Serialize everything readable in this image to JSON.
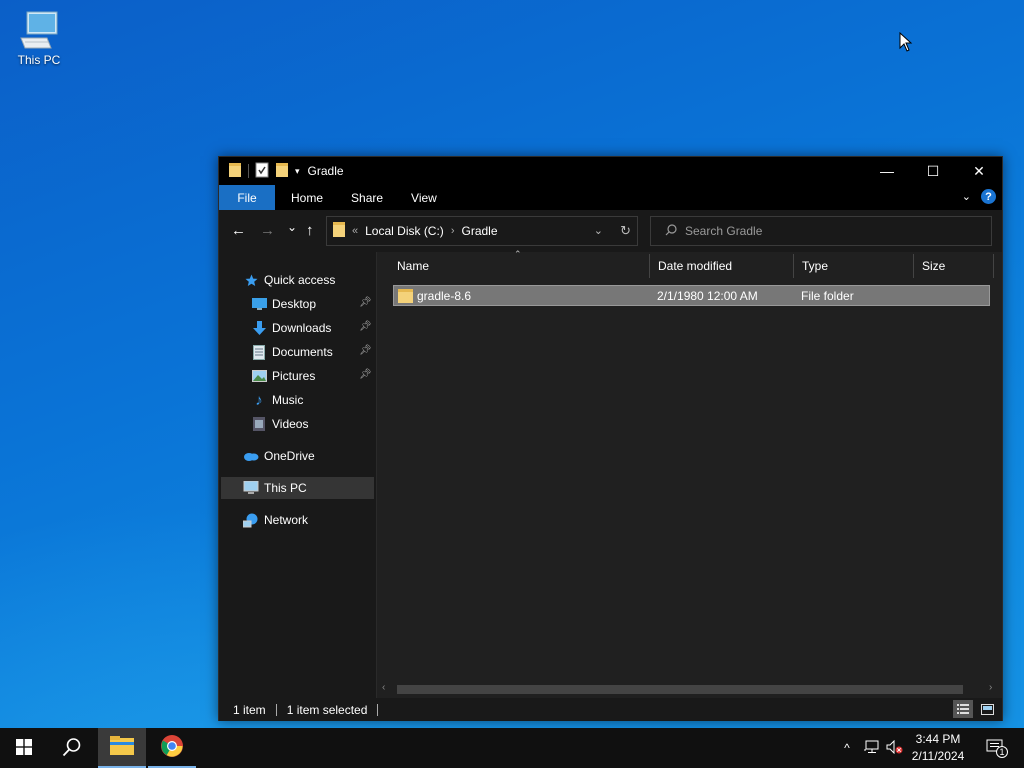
{
  "desktop": {
    "icons": [
      {
        "label": "This PC",
        "icon": "this-pc-icon"
      }
    ]
  },
  "window": {
    "title": "Gradle",
    "controls": {
      "minimize": "—",
      "maximize": "☐",
      "close": "✕"
    }
  },
  "ribbon": {
    "tabs": [
      "File",
      "Home",
      "Share",
      "View"
    ],
    "help": "?"
  },
  "navigation": {
    "back": "←",
    "forward": "→",
    "recent": "⌄",
    "up": "↑",
    "breadcrumb_overflow": "«",
    "breadcrumbs": [
      "Local Disk (C:)",
      "Gradle"
    ],
    "search_placeholder": "Search Gradle"
  },
  "sidebar": {
    "items": [
      {
        "label": "Quick access",
        "icon": "star-icon",
        "pinned": false
      },
      {
        "label": "Desktop",
        "icon": "desktop-folder-icon",
        "pinned": true
      },
      {
        "label": "Downloads",
        "icon": "downloads-icon",
        "pinned": true
      },
      {
        "label": "Documents",
        "icon": "documents-icon",
        "pinned": true
      },
      {
        "label": "Pictures",
        "icon": "pictures-icon",
        "pinned": true
      },
      {
        "label": "Music",
        "icon": "music-icon",
        "pinned": false
      },
      {
        "label": "Videos",
        "icon": "videos-icon",
        "pinned": false
      },
      {
        "label": "OneDrive",
        "icon": "onedrive-icon",
        "pinned": false
      },
      {
        "label": "This PC",
        "icon": "this-pc-icon",
        "pinned": false,
        "selected": true
      },
      {
        "label": "Network",
        "icon": "network-icon",
        "pinned": false
      }
    ]
  },
  "file_list": {
    "columns": [
      "Name",
      "Date modified",
      "Type",
      "Size"
    ],
    "rows": [
      {
        "name": "gradle-8.6",
        "date_modified": "2/1/1980 12:00 AM",
        "type": "File folder",
        "size": "",
        "selected": true
      }
    ]
  },
  "status": {
    "item_count": "1 item",
    "selected_count": "1 item selected"
  },
  "taskbar": {
    "clock_time": "3:44 PM",
    "clock_date": "2/11/2024",
    "notification_count": "1",
    "tray_expand": "^"
  },
  "colors": {
    "accent": "#1a6fc4",
    "window_bg": "#191919",
    "selection": "#777777",
    "taskbar": "#101010"
  }
}
